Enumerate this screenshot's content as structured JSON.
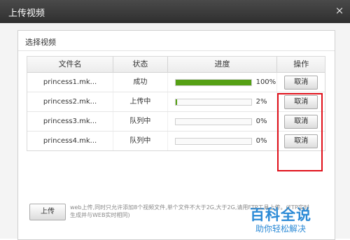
{
  "window": {
    "title": "上传视频",
    "close_glyph": "×"
  },
  "panel": {
    "title": "选择视频"
  },
  "table": {
    "headers": [
      "文件名",
      "状态",
      "进度",
      "操作"
    ],
    "rows": [
      {
        "name": "princess1.mk...",
        "status": "成功",
        "progress": 100,
        "progress_text": "100%",
        "action": "取消"
      },
      {
        "name": "princess2.mk...",
        "status": "上传中",
        "progress": 2,
        "progress_text": "2%",
        "action": "取消"
      },
      {
        "name": "princess3.mk...",
        "status": "队列中",
        "progress": 0,
        "progress_text": "0%",
        "action": "取消"
      },
      {
        "name": "princess4.mk...",
        "status": "队列中",
        "progress": 0,
        "progress_text": "0%",
        "action": "取消"
      }
    ]
  },
  "footer": {
    "upload_label": "上传",
    "note": "web上传,同时只允许添加8个视频文件,单个文件不大于2G,大于2G,请用FTP工具上传。(FTP实时生成并与WEB实时相同)"
  },
  "watermark": {
    "line1": "百科全说",
    "line2": "助你轻松解决"
  },
  "colors": {
    "progress_fill": "#55a014",
    "highlight_border": "#e0101a",
    "watermark": "#2b8ad6"
  }
}
